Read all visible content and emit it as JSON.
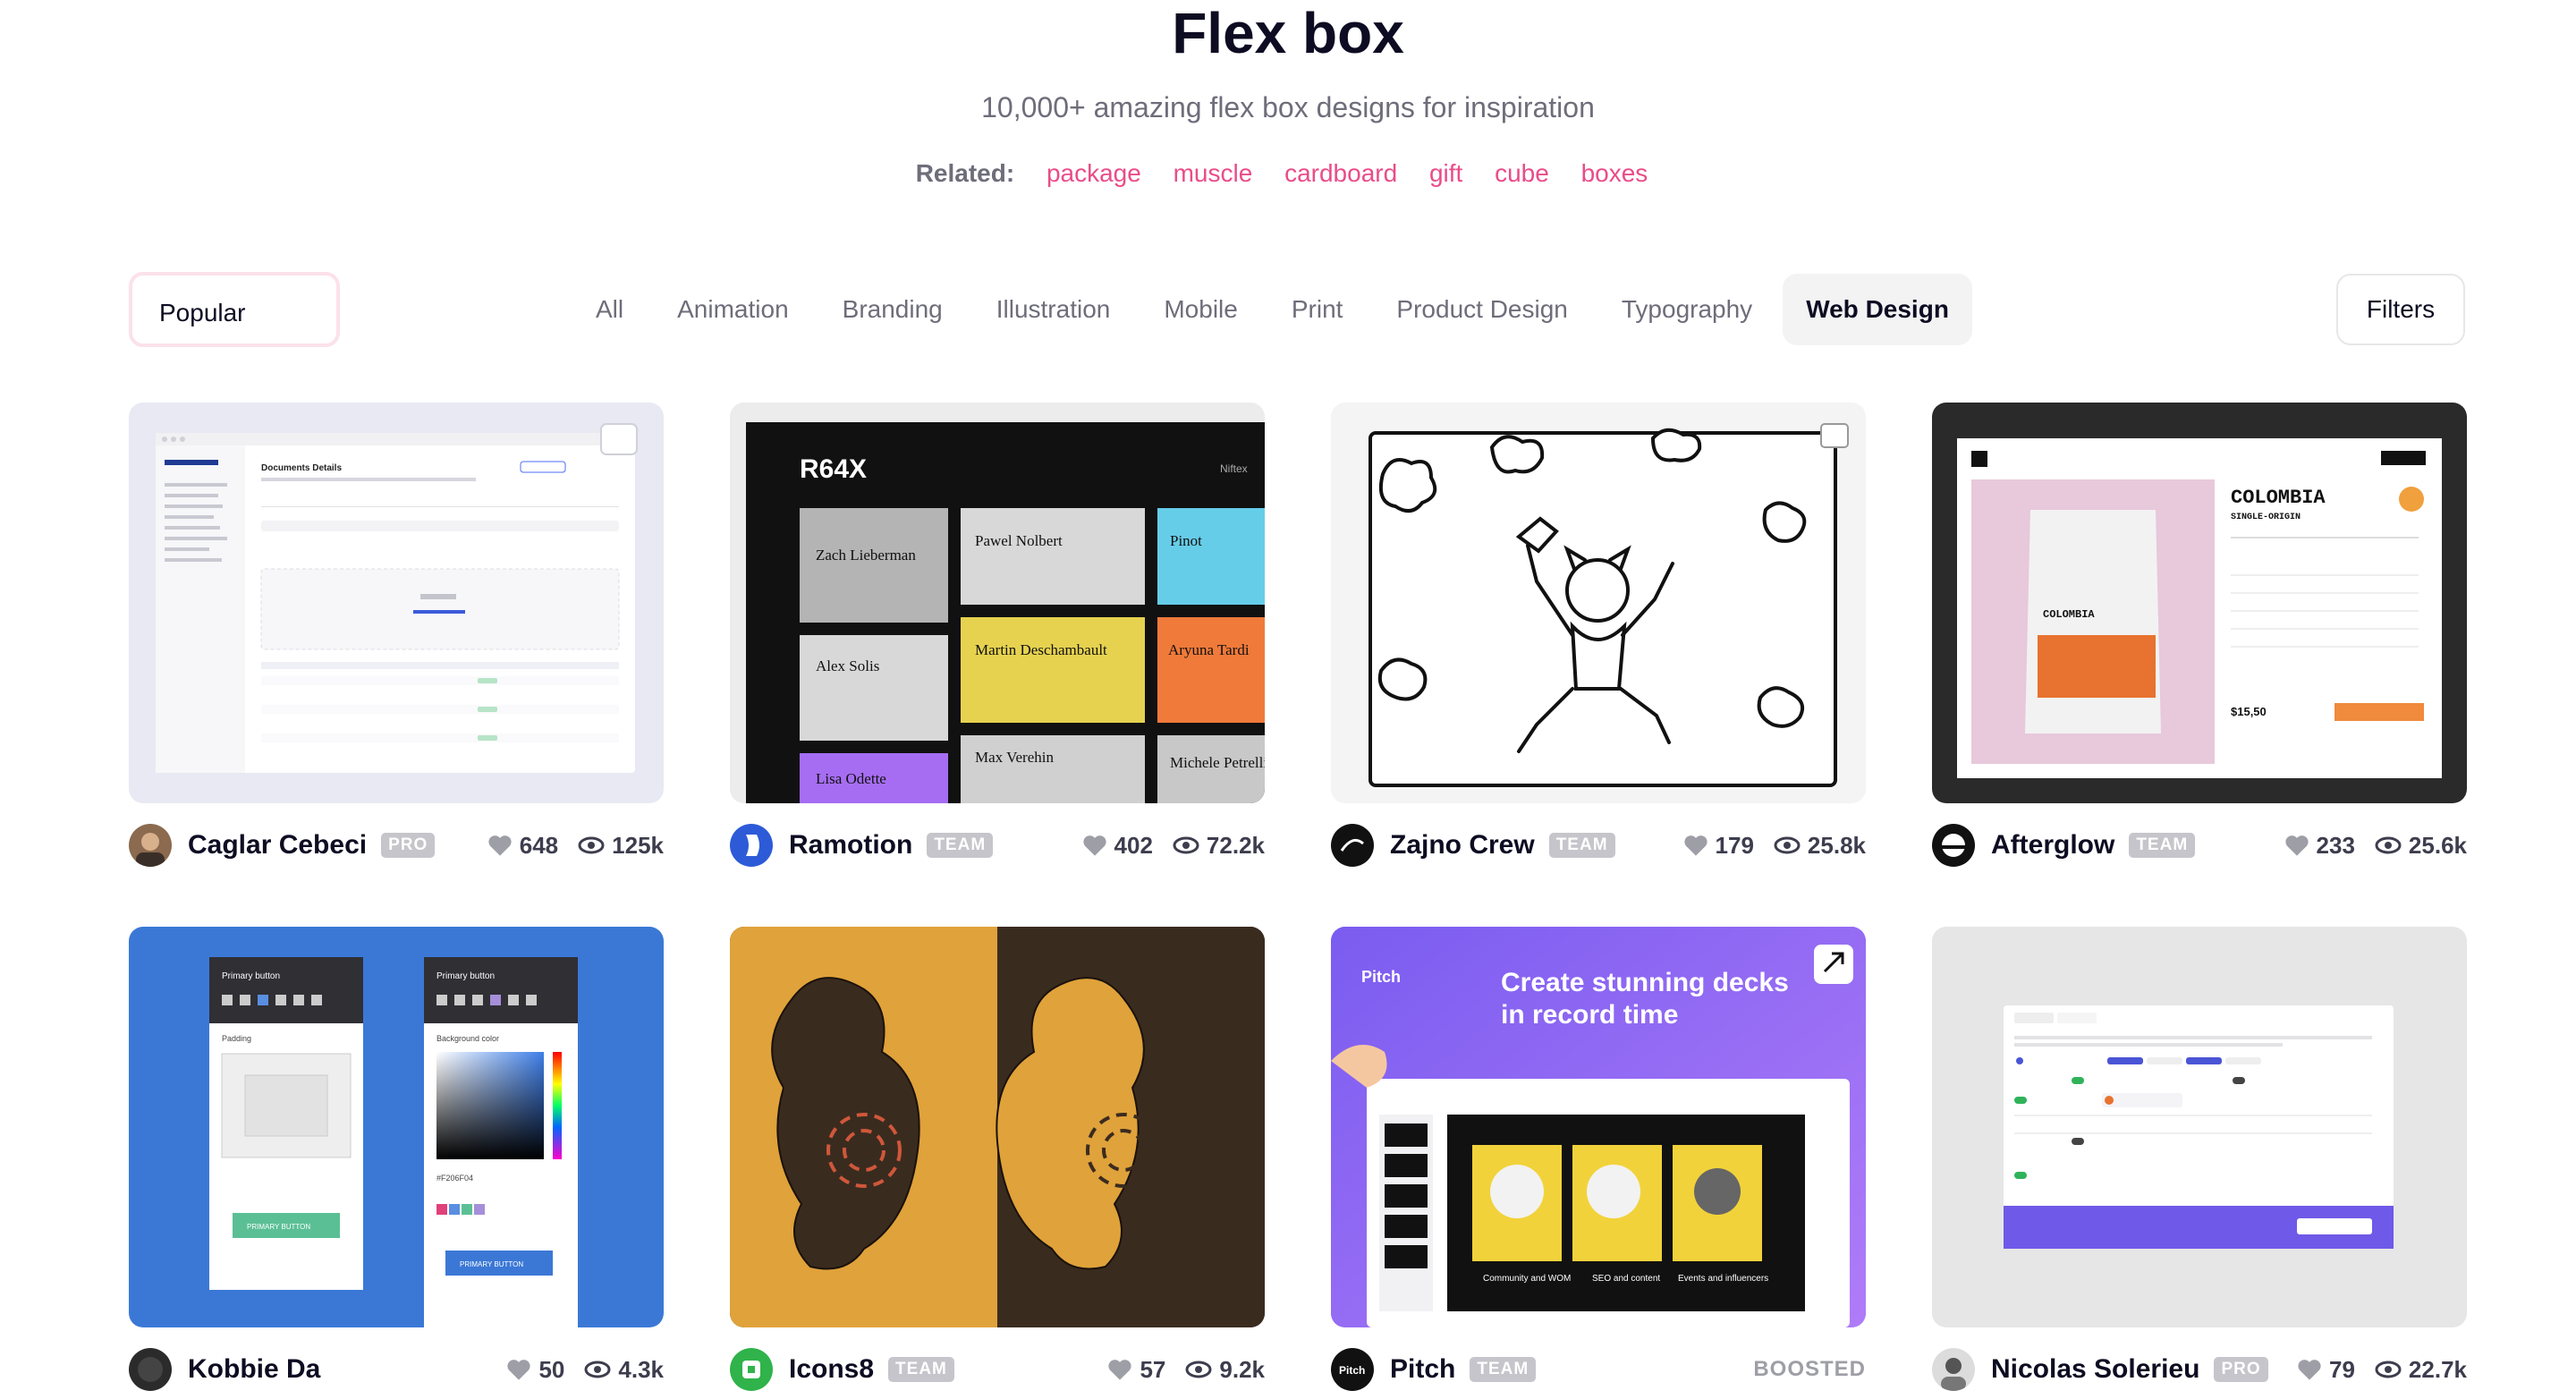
{
  "header": {
    "title": "Flex box",
    "subtitle": "10,000+ amazing flex box designs for inspiration",
    "related_label": "Related:",
    "related": [
      "package",
      "muscle",
      "cardboard",
      "gift",
      "cube",
      "boxes"
    ]
  },
  "filter_bar": {
    "sort": "Popular",
    "categories": [
      "All",
      "Animation",
      "Branding",
      "Illustration",
      "Mobile",
      "Print",
      "Product Design",
      "Typography",
      "Web Design"
    ],
    "active_category": "Web Design",
    "filters_label": "Filters"
  },
  "shots": [
    {
      "author": "Caglar Cebeci",
      "badge": "PRO",
      "likes": "648",
      "views": "125k"
    },
    {
      "author": "Ramotion",
      "badge": "TEAM",
      "likes": "402",
      "views": "72.2k"
    },
    {
      "author": "Zajno Crew",
      "badge": "TEAM",
      "likes": "179",
      "views": "25.8k"
    },
    {
      "author": "Afterglow",
      "badge": "TEAM",
      "likes": "233",
      "views": "25.6k"
    },
    {
      "author": "Kobbie Da",
      "badge": "",
      "likes": "50",
      "views": "4.3k"
    },
    {
      "author": "Icons8",
      "badge": "TEAM",
      "likes": "57",
      "views": "9.2k"
    },
    {
      "author": "Pitch",
      "badge": "TEAM",
      "boosted": "BOOSTED"
    },
    {
      "author": "Nicolas Solerieu",
      "badge": "PRO",
      "likes": "79",
      "views": "22.7k"
    }
  ],
  "thumb_text": {
    "doc_title": "Documents Details",
    "r64x": "R64X",
    "niftex": "Niftex",
    "names": [
      "Zach Lieberman",
      "Pawel Nolbert",
      "Pinot",
      "Alex Solis",
      "Martin Deschambault",
      "Aryuna Tardi",
      "Lisa Odette",
      "Max Verehin",
      "Michele Petrelli"
    ],
    "coffee_title": "COLOMBIA",
    "coffee_sub": "SINGLE-ORIGIN",
    "coffee_price": "$15,50",
    "primary_button": "Primary button",
    "padding": "Padding",
    "background_color": "Background color",
    "hex": "#F206F04",
    "primary_btn_label": "PRIMARY BUTTON",
    "pitch_logo": "Pitch",
    "pitch_headline": "Create stunning decks in record time",
    "pitch_cards": [
      "Community and WOM",
      "SEO and content",
      "Events and influencers"
    ]
  },
  "colors": {
    "accent": "#ea4c89",
    "text": "#0d0c22",
    "muted": "#6e6d7a",
    "badge": "#c5c5cb"
  }
}
